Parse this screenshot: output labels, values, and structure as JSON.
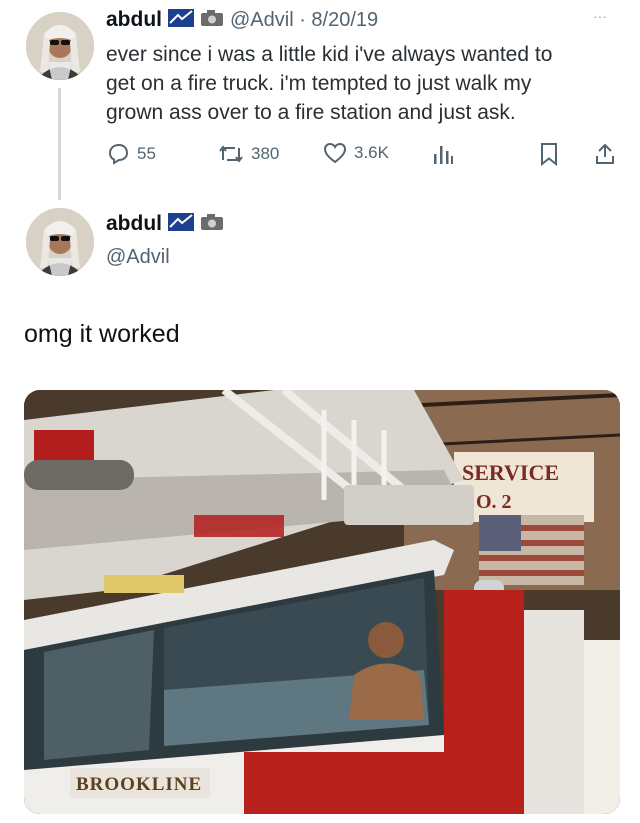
{
  "tweet1": {
    "display_name": "abdul",
    "handle_date": "@Advil · 8/20/19",
    "text_lines": [
      "ever since i was a little kid i've always wanted to",
      "get on a fire truck. i'm tempted to just walk my",
      "grown ass over to a fire station and just ask."
    ],
    "menu_label": "···",
    "replies": "55",
    "retweets": "380",
    "likes": "3.6K"
  },
  "tweet2": {
    "display_name": "abdul",
    "handle": "@Advil",
    "text": "omg it worked",
    "photo": {
      "station_sign_line1": "SERVICE",
      "station_sign_line2": "O. 2",
      "truck_label": "BROOKLINE"
    }
  },
  "icons": [
    "reply-icon",
    "retweet-icon",
    "like-icon",
    "views-icon",
    "bookmark-icon",
    "share-icon",
    "camera-icon",
    "flag-badge-icon"
  ],
  "colors": {
    "muted_text": "#536471",
    "truck_red": "#b8201c",
    "thread_line": "#d6d9dc"
  }
}
